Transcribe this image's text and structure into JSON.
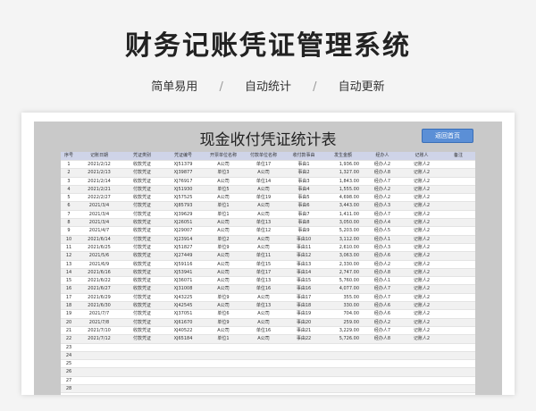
{
  "page": {
    "title": "财务记账凭证管理系统",
    "features": [
      "简单易用",
      "自动统计",
      "自动更新"
    ],
    "separator": "/"
  },
  "sheet": {
    "title": "现金收付凭证统计表",
    "back_button": "返回首页",
    "columns": [
      "序号",
      "记账日期",
      "凭证类别",
      "凭证编号",
      "开票单位名称",
      "付款单位名称",
      "收付款事由",
      "发生金额",
      "经办人",
      "记账人",
      "备注"
    ],
    "rows": [
      [
        "1",
        "2021/2/12",
        "收款凭证",
        "XJ51379",
        "A公司",
        "单位17",
        "事由1",
        "1,936.00",
        "经办人2",
        "记账人2",
        ""
      ],
      [
        "2",
        "2021/2/13",
        "付款凭证",
        "XJ39877",
        "单位3",
        "A公司",
        "事由2",
        "1,327.00",
        "经办人8",
        "记账人2",
        ""
      ],
      [
        "3",
        "2021/2/14",
        "收款凭证",
        "XJ76917",
        "A公司",
        "单位14",
        "事由3",
        "1,843.00",
        "经办人7",
        "记账人2",
        ""
      ],
      [
        "4",
        "2021/2/21",
        "付款凭证",
        "XJ51930",
        "单位5",
        "A公司",
        "事由4",
        "1,555.00",
        "经办人2",
        "记账人2",
        ""
      ],
      [
        "5",
        "2022/2/27",
        "收款凭证",
        "XJ57525",
        "A公司",
        "单位19",
        "事由5",
        "4,698.00",
        "经办人2",
        "记账人2",
        ""
      ],
      [
        "6",
        "2021/3/4",
        "付款凭证",
        "XJ85793",
        "单位1",
        "A公司",
        "事由6",
        "3,443.00",
        "经办人3",
        "记账人2",
        ""
      ],
      [
        "7",
        "2021/3/4",
        "付款凭证",
        "XJ39629",
        "单位1",
        "A公司",
        "事由7",
        "1,411.00",
        "经办人7",
        "记账人2",
        ""
      ],
      [
        "8",
        "2021/3/4",
        "收款凭证",
        "XJ26051",
        "A公司",
        "单位13",
        "事由8",
        "3,050.00",
        "经办人4",
        "记账人2",
        ""
      ],
      [
        "9",
        "2021/4/7",
        "收款凭证",
        "XJ29007",
        "A公司",
        "单位12",
        "事由9",
        "5,203.00",
        "经办人5",
        "记账人2",
        ""
      ],
      [
        "10",
        "2021/6/14",
        "付款凭证",
        "XJ23914",
        "单位2",
        "A公司",
        "事由10",
        "3,112.00",
        "经办人1",
        "记账人2",
        ""
      ],
      [
        "11",
        "2021/6/25",
        "付款凭证",
        "XJ51827",
        "单位9",
        "A公司",
        "事由11",
        "2,610.00",
        "经办人3",
        "记账人2",
        ""
      ],
      [
        "12",
        "2021/5/6",
        "收款凭证",
        "XJ27449",
        "A公司",
        "单位11",
        "事由12",
        "3,063.00",
        "经办人6",
        "记账人2",
        ""
      ],
      [
        "13",
        "2021/6/9",
        "收款凭证",
        "XJ59116",
        "A公司",
        "单位15",
        "事由13",
        "2,330.00",
        "经办人2",
        "记账人2",
        ""
      ],
      [
        "14",
        "2021/6/16",
        "收款凭证",
        "XJ53941",
        "A公司",
        "单位17",
        "事由14",
        "2,747.00",
        "经办人8",
        "记账人2",
        ""
      ],
      [
        "15",
        "2021/6/22",
        "收款凭证",
        "XJ36071",
        "A公司",
        "单位13",
        "事由15",
        "5,760.00",
        "经办人1",
        "记账人2",
        ""
      ],
      [
        "16",
        "2021/6/27",
        "收款凭证",
        "XJ31008",
        "A公司",
        "单位16",
        "事由16",
        "4,077.00",
        "经办人7",
        "记账人2",
        ""
      ],
      [
        "17",
        "2021/6/29",
        "付款凭证",
        "XJ43225",
        "单位9",
        "A公司",
        "事由17",
        "355.00",
        "经办人7",
        "记账人2",
        ""
      ],
      [
        "18",
        "2021/6/30",
        "收款凭证",
        "XJ42545",
        "A公司",
        "单位13",
        "事由18",
        "330.00",
        "经办人6",
        "记账人2",
        ""
      ],
      [
        "19",
        "2021/7/7",
        "付款凭证",
        "XJ37051",
        "单位6",
        "A公司",
        "事由19",
        "704.00",
        "经办人6",
        "记账人2",
        ""
      ],
      [
        "20",
        "2021/7/8",
        "付款凭证",
        "XJ61670",
        "单位9",
        "A公司",
        "事由20",
        "259.00",
        "经办人2",
        "记账人2",
        ""
      ],
      [
        "21",
        "2021/7/10",
        "收款凭证",
        "XJ40522",
        "A公司",
        "单位16",
        "事由21",
        "3,229.00",
        "经办人7",
        "记账人2",
        ""
      ],
      [
        "22",
        "2021/7/12",
        "付款凭证",
        "XJ65184",
        "单位1",
        "A公司",
        "事由22",
        "5,726.00",
        "经办人8",
        "记账人2",
        ""
      ],
      [
        "23",
        "",
        "",
        "",
        "",
        "",
        "",
        "",
        "",
        "",
        ""
      ],
      [
        "24",
        "",
        "",
        "",
        "",
        "",
        "",
        "",
        "",
        "",
        ""
      ],
      [
        "25",
        "",
        "",
        "",
        "",
        "",
        "",
        "",
        "",
        "",
        ""
      ],
      [
        "26",
        "",
        "",
        "",
        "",
        "",
        "",
        "",
        "",
        "",
        ""
      ],
      [
        "27",
        "",
        "",
        "",
        "",
        "",
        "",
        "",
        "",
        "",
        ""
      ],
      [
        "28",
        "",
        "",
        "",
        "",
        "",
        "",
        "",
        "",
        "",
        ""
      ]
    ]
  }
}
